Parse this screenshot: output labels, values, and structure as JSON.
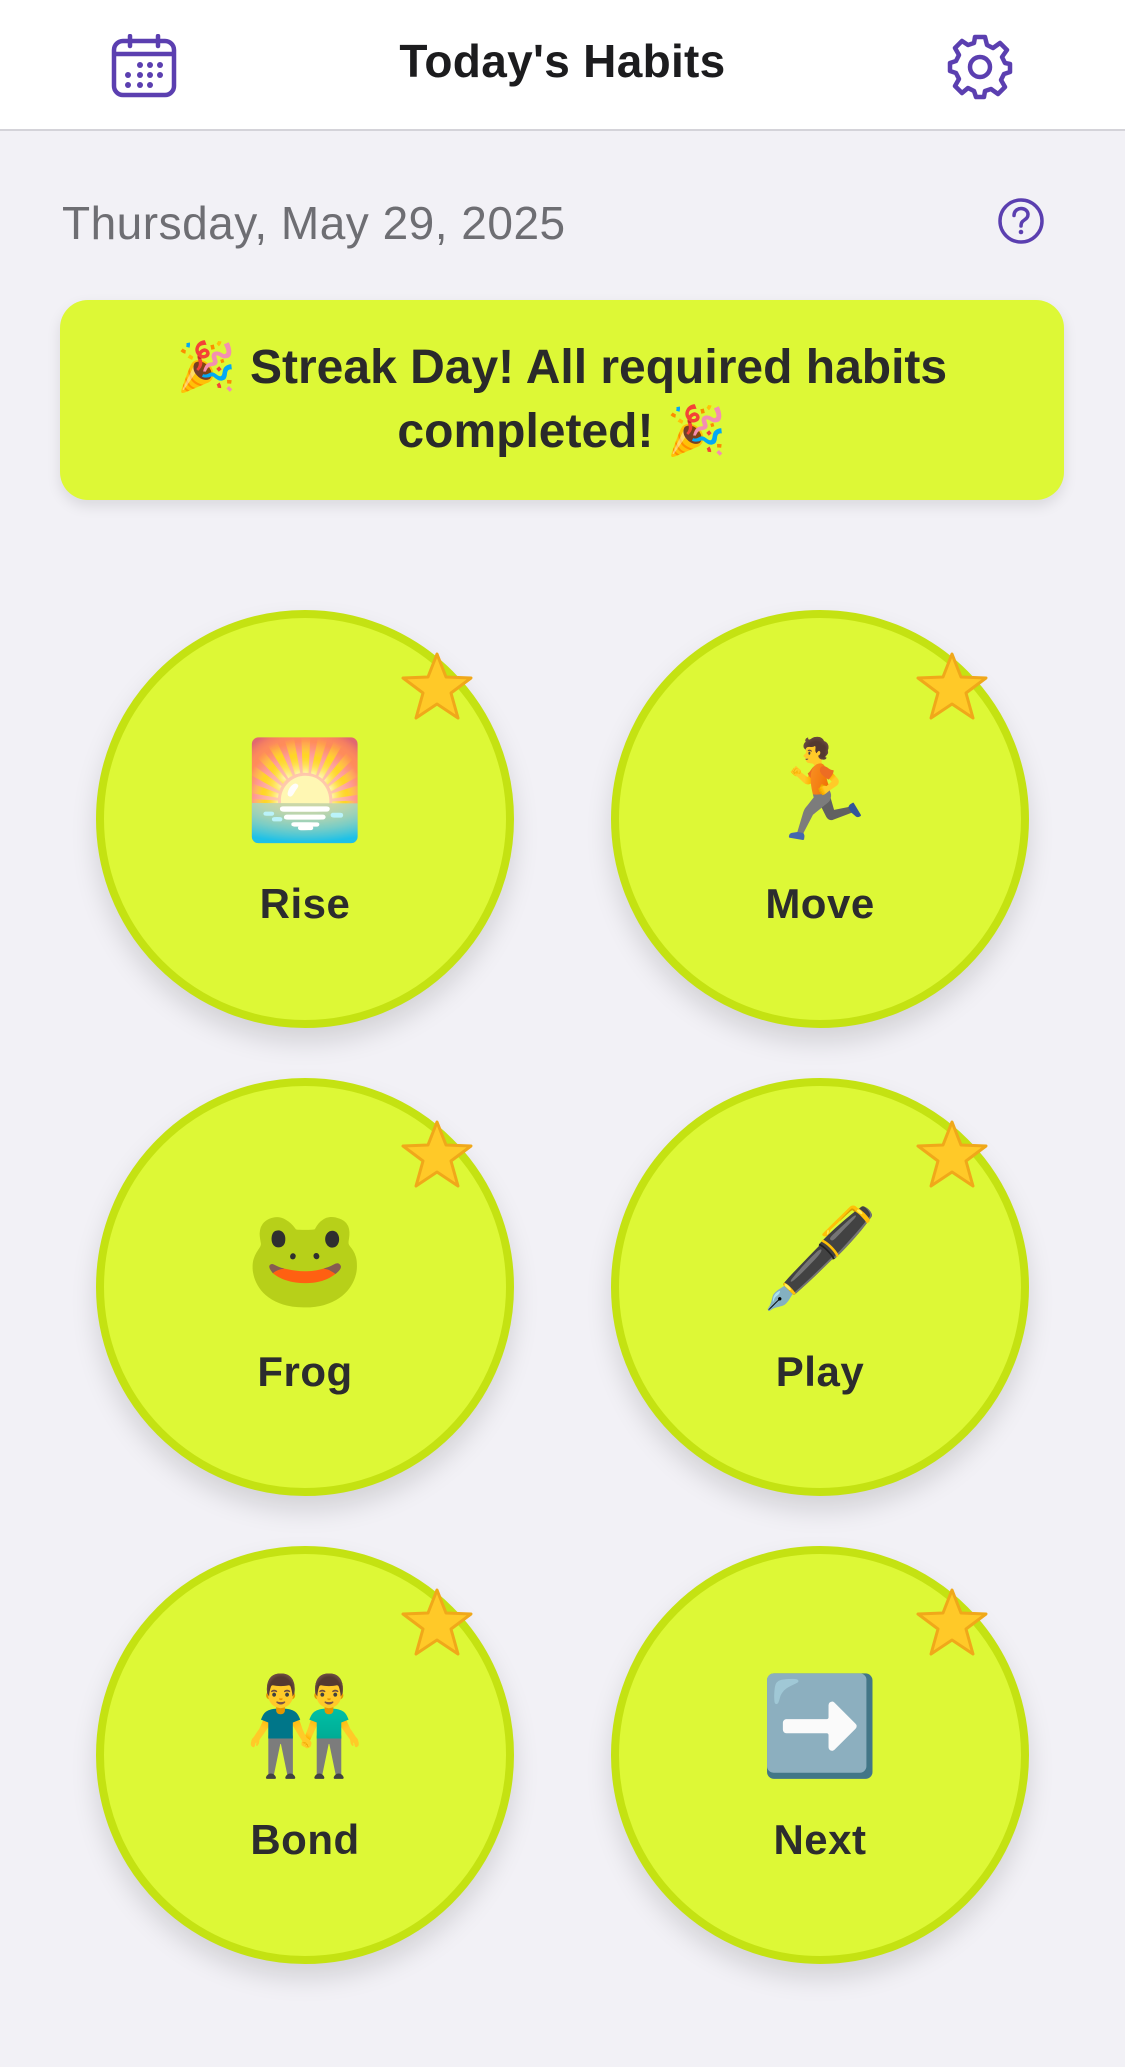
{
  "header": {
    "title": "Today's Habits",
    "left_icon": "calendar-icon",
    "right_icon": "gear-icon"
  },
  "date": {
    "text": "Thursday, May 29, 2025",
    "help_icon": "question-circle-icon"
  },
  "banner": {
    "text": "🎉 Streak Day! All required habits completed! 🎉"
  },
  "habits": [
    {
      "label": "Rise",
      "emoji": "🌅",
      "starred": true
    },
    {
      "label": "Move",
      "emoji": "🏃",
      "starred": true
    },
    {
      "label": "Frog",
      "emoji": "🐸",
      "starred": true
    },
    {
      "label": "Play",
      "emoji": "🖋️",
      "starred": true
    },
    {
      "label": "Bond",
      "emoji": "👬",
      "starred": true
    },
    {
      "label": "Next",
      "emoji": "➡️",
      "starred": true
    }
  ],
  "colors": {
    "accent": "#5b3fb0",
    "habit_fill": "#ddf836",
    "habit_border": "#c4e212",
    "background": "#f2f1f6",
    "star": "#ffc928"
  }
}
